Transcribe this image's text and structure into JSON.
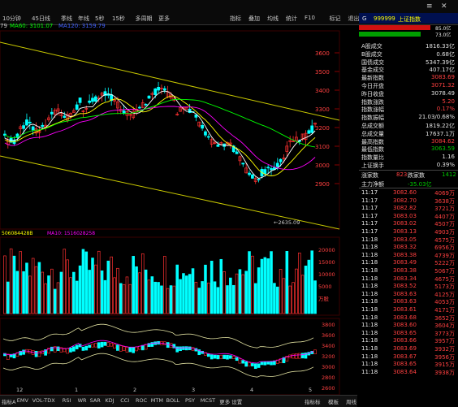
{
  "toolbar": {
    "period_tabs": [
      "10分钟",
      "45日线",
      "季线",
      "年线",
      "5秒",
      "15秒",
      "多周期",
      "更多"
    ],
    "right_tools": [
      "指标",
      "叠加",
      "均线",
      "统计",
      "F10",
      "标记",
      "退出"
    ]
  },
  "ma_line": {
    "ma60": "MA60: 3101.07",
    "ma120": "MA120: 3159.79",
    "prefix": "79"
  },
  "quote_header": {
    "label_g": "G",
    "code": "999999",
    "name": "上证指数"
  },
  "ratio_bar": {
    "top": "85.0亿",
    "bottom": "73.0亿"
  },
  "quote_rows": [
    {
      "label": "A股成交",
      "value": "1816.33亿",
      "color": "#e0e0e0"
    },
    {
      "label": "B股成交",
      "value": "0.68亿",
      "color": "#e0e0e0"
    },
    {
      "label": "国债成交",
      "value": "5347.39亿",
      "color": "#e0e0e0"
    },
    {
      "label": "基金成交",
      "value": "407.17亿",
      "color": "#e0e0e0"
    },
    {
      "label": "最新指数",
      "value": "3083.69",
      "color": "#ff4040"
    },
    {
      "label": "今日开盘",
      "value": "3071.32",
      "color": "#ff4040"
    },
    {
      "label": "昨日收盘",
      "value": "3078.49",
      "color": "#e0e0e0"
    },
    {
      "label": "指数涨跌",
      "value": "5.20",
      "color": "#ff4040"
    },
    {
      "label": "指数涨幅",
      "value": "0.17%",
      "color": "#ff4040"
    },
    {
      "label": "指数振幅",
      "value": "21.03/0.68%",
      "color": "#e0e0e0"
    },
    {
      "label": "总成交额",
      "value": "1819.22亿",
      "color": "#e0e0e0"
    },
    {
      "label": "总成交量",
      "value": "17637.1万",
      "color": "#e0e0e0"
    },
    {
      "label": "最高指数",
      "value": "3084.62",
      "color": "#ff4040"
    },
    {
      "label": "最低指数",
      "value": "3063.59",
      "color": "#00c800"
    },
    {
      "label": "指数量比",
      "value": "1.16",
      "color": "#e0e0e0"
    },
    {
      "label": "上证换手",
      "value": "0.39%",
      "color": "#e0e0e0"
    }
  ],
  "updown": {
    "up_label": "涨家数",
    "up_value": "823",
    "down_label": "跌家数",
    "down_value": "1412"
  },
  "netflow": {
    "label": "主力净额",
    "value": "-35.03亿"
  },
  "ticks": [
    {
      "time": "11:17",
      "price": "3082.60",
      "vol": "4069万",
      "c": "r"
    },
    {
      "time": "11:17",
      "price": "3082.70",
      "vol": "3638万",
      "c": "r"
    },
    {
      "time": "11:17",
      "price": "3082.82",
      "vol": "3721万",
      "c": "r"
    },
    {
      "time": "11:17",
      "price": "3083.03",
      "vol": "4407万",
      "c": "r"
    },
    {
      "time": "11:17",
      "price": "3083.02",
      "vol": "4507万",
      "c": "r"
    },
    {
      "time": "11:17",
      "price": "3083.13",
      "price2": "",
      "vol": "4903万",
      "c": "r"
    },
    {
      "time": "11:18",
      "price": "3083.05",
      "vol": "4575万",
      "c": "r"
    },
    {
      "time": "11:18",
      "price": "3083.32",
      "vol": "6956万",
      "c": "r"
    },
    {
      "time": "11:18",
      "price": "3083.38",
      "vol": "4739万",
      "c": "r"
    },
    {
      "time": "11:18",
      "price": "3083.49",
      "vol": "5222万",
      "c": "r"
    },
    {
      "time": "11:18",
      "price": "3083.38",
      "vol": "5067万",
      "c": "r"
    },
    {
      "time": "11:18",
      "price": "3083.34",
      "vol": "4675万",
      "c": "r"
    },
    {
      "time": "11:18",
      "price": "3083.52",
      "vol": "5173万",
      "c": "r"
    },
    {
      "time": "11:18",
      "price": "3083.63",
      "vol": "4125万",
      "c": "r"
    },
    {
      "time": "11:18",
      "price": "3083.63",
      "vol": "4053万",
      "c": "r"
    },
    {
      "time": "11:18",
      "price": "3083.61",
      "vol": "4171万",
      "c": "r"
    },
    {
      "time": "11:18",
      "price": "3083.68",
      "vol": "3652万",
      "c": "r"
    },
    {
      "time": "11:18",
      "price": "3083.60",
      "vol": "3604万",
      "c": "r"
    },
    {
      "time": "11:18",
      "price": "3083.65",
      "vol": "3773万",
      "c": "r"
    },
    {
      "time": "11:18",
      "price": "3083.66",
      "vol": "3957万",
      "c": "r"
    },
    {
      "time": "11:18",
      "price": "3083.69",
      "vol": "3932万",
      "c": "r"
    },
    {
      "time": "11:18",
      "price": "3083.67",
      "vol": "3956万",
      "c": "r"
    },
    {
      "time": "11:18",
      "price": "3083.65",
      "vol": "3915万",
      "c": "r"
    },
    {
      "time": "11:18",
      "price": "3083.64",
      "vol": "3938万",
      "c": "r"
    }
  ],
  "price_axis": [
    "3600",
    "3500",
    "3400",
    "3300",
    "3200",
    "3100",
    "3000",
    "2900"
  ],
  "price_low_label": "2635.09",
  "vol_header": {
    "v1": "506084428B",
    "v2": "MA10: 1516028258"
  },
  "vol_axis": [
    "20000",
    "15000",
    "10000",
    "5000",
    "万股"
  ],
  "ind_axis": [
    "3800",
    "3600",
    "3400",
    "3200",
    "3000",
    "2800",
    "2600"
  ],
  "date_labels": [
    "12",
    "1",
    "2",
    "3",
    "4",
    "5"
  ],
  "bottom_tabs": [
    "指标A",
    "EMV",
    "VOL-TDX",
    "RSI",
    "WR",
    "SAR",
    "KDJ",
    "CCI",
    "ROC",
    "MTM",
    "BOLL",
    "PSY",
    "MCST",
    "更多",
    "设置"
  ],
  "bottom_right": [
    "指标标",
    "模板",
    "周线"
  ],
  "colors": {
    "up": "#ff3030",
    "down": "#00ffff",
    "ma5": "#ffffff",
    "ma10": "#ffff00",
    "ma20": "#ff00ff",
    "ma60": "#00ff00",
    "channel": "#c8c800"
  }
}
